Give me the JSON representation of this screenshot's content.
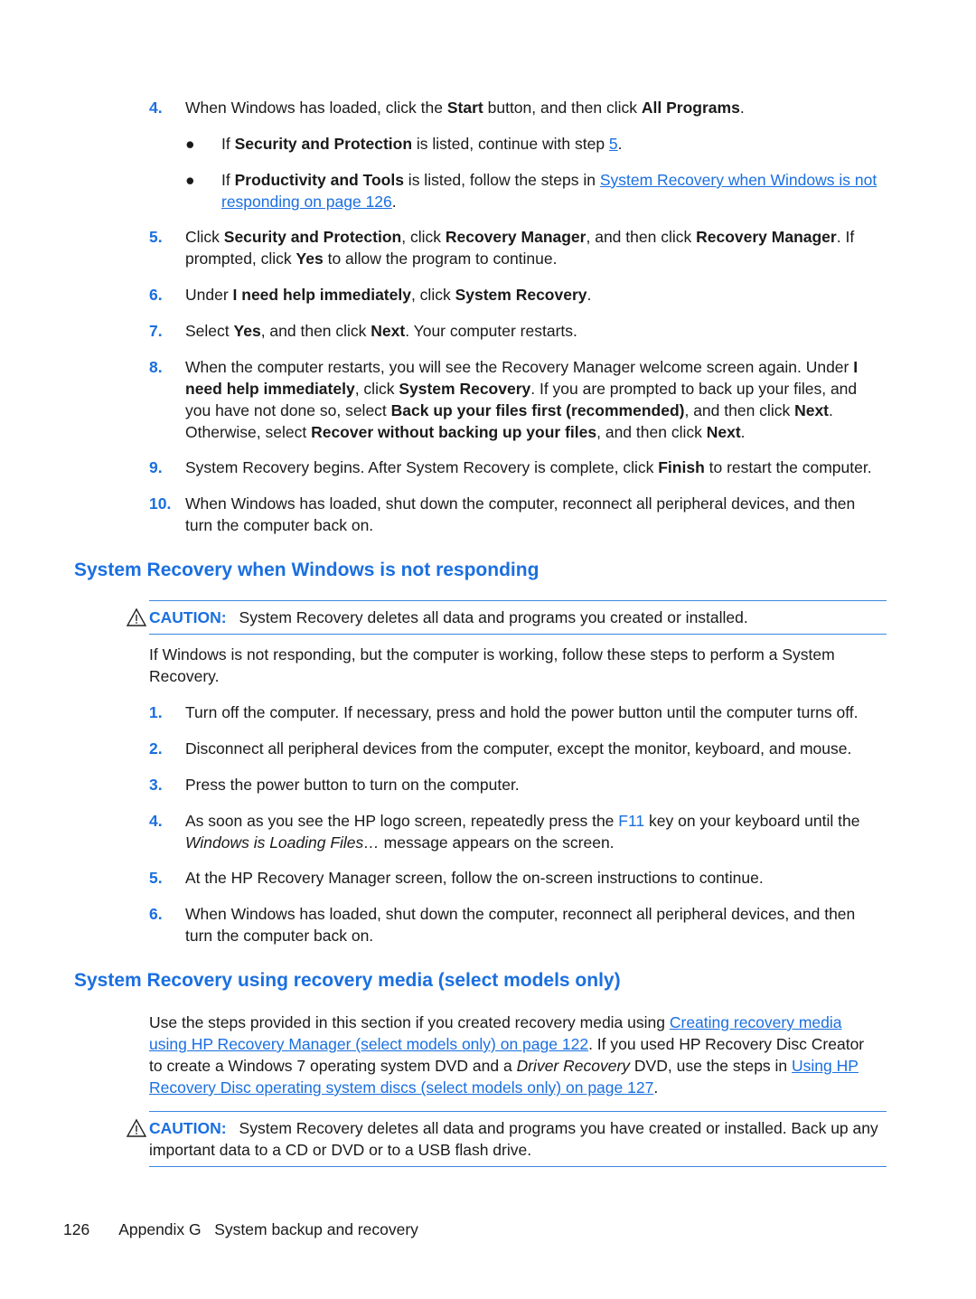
{
  "steps_top": [
    {
      "num": "4.",
      "parts": [
        "When Windows has loaded, click the ",
        "Start",
        " button, and then click ",
        "All Programs",
        "."
      ]
    },
    {
      "num": "5.",
      "parts": [
        "Click ",
        "Security and Protection",
        ", click ",
        "Recovery Manager",
        ", and then click ",
        "Recovery Manager",
        ". If prompted, click ",
        "Yes",
        " to allow the program to continue."
      ]
    },
    {
      "num": "6.",
      "parts": [
        "Under ",
        "I need help immediately",
        ", click ",
        "System Recovery",
        "."
      ]
    },
    {
      "num": "7.",
      "parts": [
        "Select ",
        "Yes",
        ", and then click ",
        "Next",
        ". Your computer restarts."
      ]
    },
    {
      "num": "8.",
      "parts": [
        "When the computer restarts, you will see the Recovery Manager welcome screen again. Under ",
        "I need help immediately",
        ", click ",
        "System Recovery",
        ". If you are prompted to back up your files, and you have not done so, select ",
        "Back up your files first (recommended)",
        ", and then click ",
        "Next",
        ". Otherwise, select ",
        "Recover without backing up your files",
        ", and then click ",
        "Next",
        "."
      ]
    },
    {
      "num": "9.",
      "parts": [
        "System Recovery begins. After System Recovery is complete, click ",
        "Finish",
        " to restart the computer."
      ]
    },
    {
      "num": "10.",
      "parts": [
        "When Windows has loaded, shut down the computer, reconnect all peripheral devices, and then turn the computer back on."
      ]
    }
  ],
  "bullets": [
    {
      "parts": [
        "If ",
        "Security and Protection",
        " is listed, continue with step "
      ],
      "link": "5",
      "after": "."
    },
    {
      "parts": [
        "If ",
        "Productivity and Tools",
        " is listed, follow the steps in "
      ],
      "link": "System Recovery when Windows is not responding on page 126",
      "after": "."
    }
  ],
  "section1": {
    "title": "System Recovery when Windows is not responding",
    "caution_label": "CAUTION:",
    "caution_text": "System Recovery deletes all data and programs you created or installed.",
    "intro": "If Windows is not responding, but the computer is working, follow these steps to perform a System Recovery.",
    "steps": [
      {
        "num": "1.",
        "text": "Turn off the computer. If necessary, press and hold the power button until the computer turns off."
      },
      {
        "num": "2.",
        "text": "Disconnect all peripheral devices from the computer, except the monitor, keyboard, and mouse."
      },
      {
        "num": "3.",
        "text": "Press the power button to turn on the computer."
      },
      {
        "num": "4.",
        "pre": "As soon as you see the HP logo screen, repeatedly press the ",
        "key": "F11",
        "mid": " key on your keyboard until the ",
        "em": "Windows is Loading Files…",
        "post": " message appears on the screen."
      },
      {
        "num": "5.",
        "text": "At the HP Recovery Manager screen, follow the on-screen instructions to continue."
      },
      {
        "num": "6.",
        "text": "When Windows has loaded, shut down the computer, reconnect all peripheral devices, and then turn the computer back on."
      }
    ]
  },
  "section2": {
    "title": "System Recovery using recovery media (select models only)",
    "p1": "Use the steps provided in this section if you created recovery media using ",
    "link1": "Creating recovery media using HP Recovery Manager (select models only) on page 122",
    "p2": ". If you used HP Recovery Disc Creator to create a Windows 7 operating system DVD and a ",
    "em": "Driver Recovery",
    "p3": " DVD, use the steps in ",
    "link2": "Using HP Recovery Disc operating system discs (select models only) on page 127",
    "p4": ".",
    "caution_label": "CAUTION:",
    "caution_text": "System Recovery deletes all data and programs you have created or installed. Back up any important data to a CD or DVD or to a USB flash drive."
  },
  "footer": {
    "page": "126",
    "text": "Appendix G   System backup and recovery"
  }
}
